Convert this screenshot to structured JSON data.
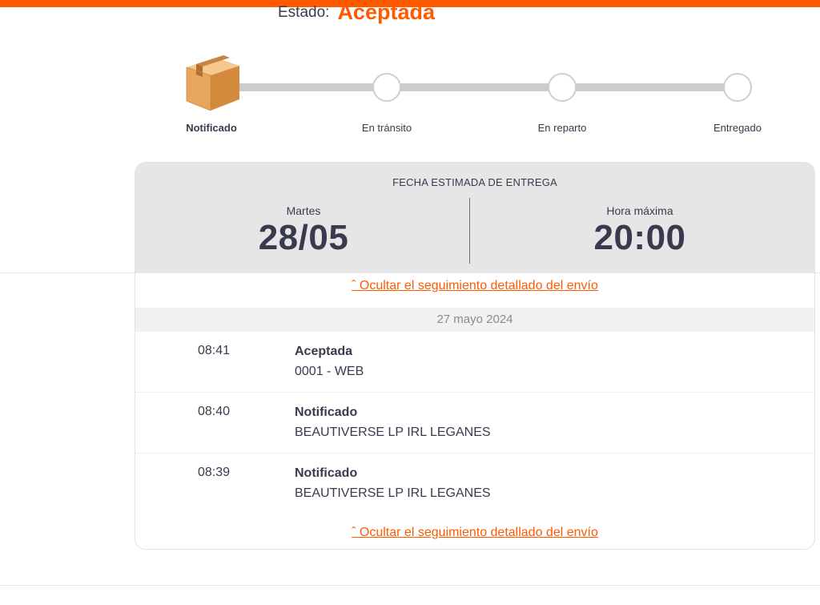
{
  "header": {
    "status_label": "Estado:",
    "status_value": "Aceptada",
    "accent_color": "#ff5a00"
  },
  "stepper": {
    "steps": [
      {
        "label": "Notificado",
        "active": true,
        "icon": "package-box-icon"
      },
      {
        "label": "En tránsito",
        "active": false
      },
      {
        "label": "En reparto",
        "active": false
      },
      {
        "label": "Entregado",
        "active": false
      }
    ]
  },
  "delivery": {
    "title": "FECHA ESTIMADA DE ENTREGA",
    "day_label": "Martes",
    "date": "28/05",
    "time_label": "Hora máxima",
    "time": "20:00"
  },
  "tracking": {
    "toggle_link": "ˆ Ocultar el seguimiento detallado del envío",
    "date_group": "27 mayo 2024",
    "events": [
      {
        "time": "08:41",
        "title": "Aceptada",
        "detail": "0001 - WEB"
      },
      {
        "time": "08:40",
        "title": "Notificado",
        "detail": "BEAUTIVERSE LP IRL LEGANES"
      },
      {
        "time": "08:39",
        "title": "Notificado",
        "detail": "BEAUTIVERSE LP IRL LEGANES"
      }
    ]
  }
}
